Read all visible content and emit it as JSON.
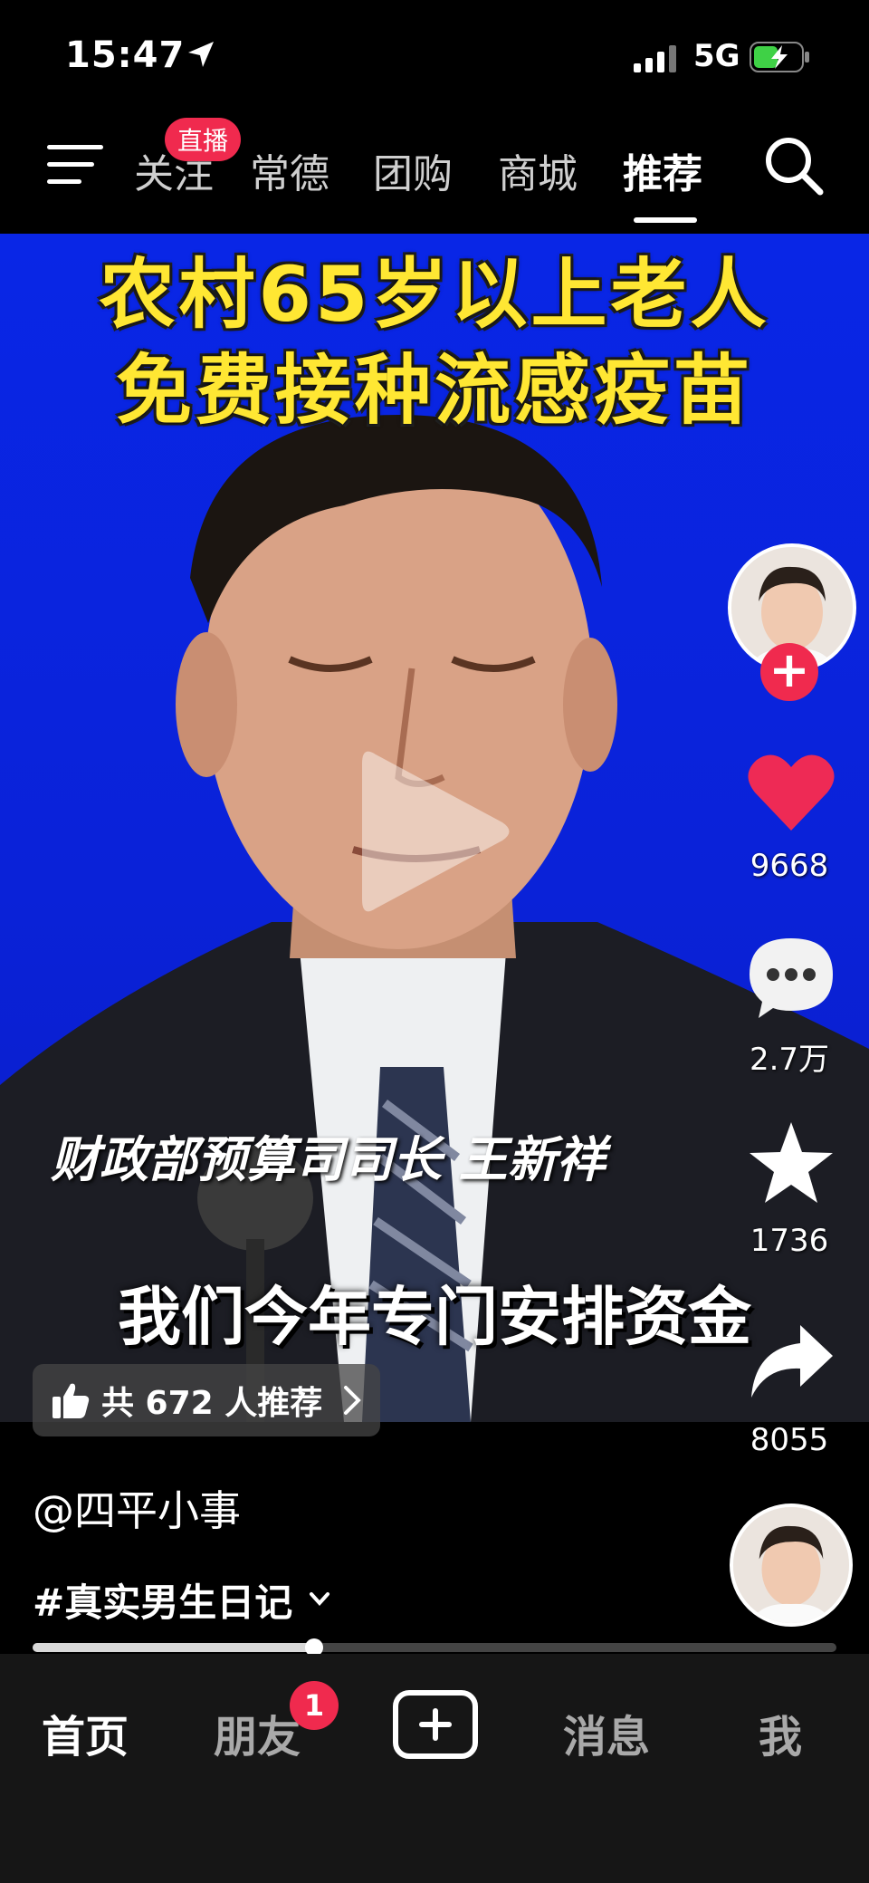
{
  "status_bar": {
    "time": "15:47",
    "network": "5G",
    "icons": [
      "location-arrow-icon",
      "signal-icon",
      "battery-charging-icon"
    ]
  },
  "top_nav": {
    "tabs": [
      {
        "label": "关注"
      },
      {
        "label": "常德"
      },
      {
        "label": "团购"
      },
      {
        "label": "商城"
      },
      {
        "label": "推荐"
      }
    ],
    "active_tab": "推荐",
    "live_badge": "直播"
  },
  "video": {
    "headline_line1": "农村65岁以上老人",
    "headline_line2": "免费接种流感疫苗",
    "caption_name": "财政部预算司司长 王新祥",
    "caption_main": "我们今年专门安排资金",
    "recommend_text": "共 672 人推荐"
  },
  "actions": {
    "likes": "9668",
    "comments": "2.7万",
    "favorites": "1736",
    "shares": "8055"
  },
  "post": {
    "author": "@四平小事",
    "hashtag": "#真实男生日记",
    "progress": 0.35
  },
  "bottom_tabs": {
    "home": "首页",
    "friends": "朋友",
    "friends_badge": "1",
    "messages": "消息",
    "me": "我"
  },
  "colors": {
    "accent": "#f02a4e",
    "headline": "#ffe733",
    "video_bg": "#0a22d8"
  }
}
